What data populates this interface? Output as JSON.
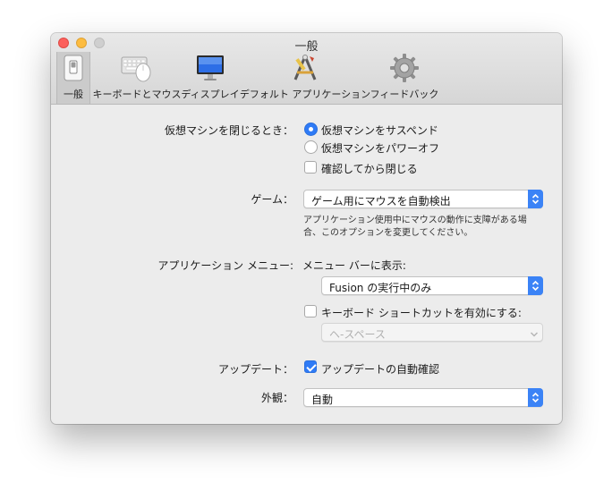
{
  "window": {
    "title": "一般"
  },
  "toolbar": {
    "tabs": [
      {
        "label": "一般",
        "icon": "general-switch-icon"
      },
      {
        "label": "キーボードとマウス",
        "icon": "keyboard-mouse-icon"
      },
      {
        "label": "ディスプレイ",
        "icon": "display-icon"
      },
      {
        "label": "デフォルト アプリケーション",
        "icon": "default-applications-icon"
      },
      {
        "label": "フィードバック",
        "icon": "gear-icon"
      }
    ]
  },
  "close_vm": {
    "label": "仮想マシンを閉じるとき：",
    "options": [
      {
        "label": "仮想マシンをサスペンド",
        "selected": true
      },
      {
        "label": "仮想マシンをパワーオフ",
        "selected": false
      }
    ],
    "confirm_label": "確認してから閉じる",
    "confirm_checked": false
  },
  "game": {
    "label": "ゲーム：",
    "value": "ゲーム用にマウスを自動検出",
    "help_line1": "アプリケーション使用中にマウスの動作に支障がある場",
    "help_line2": "合、このオプションを変更してください。"
  },
  "app_menu": {
    "label": "アプリケーション メニュー:",
    "show_in_menubar_label": "メニュー バーに表示:",
    "menubar_value": "Fusion の実行中のみ",
    "shortcut_label": "キーボード ショートカットを有効にする:",
    "shortcut_checked": false,
    "shortcut_value": "ヘ-スペース"
  },
  "update": {
    "label": "アップデート：",
    "auto_check_label": "アップデートの自動確認",
    "auto_check_checked": true
  },
  "appearance": {
    "label": "外観：",
    "value": "自動"
  },
  "colors": {
    "accent": "#2f7bf6",
    "close": "#fc605c",
    "minimize": "#fdbc40"
  }
}
